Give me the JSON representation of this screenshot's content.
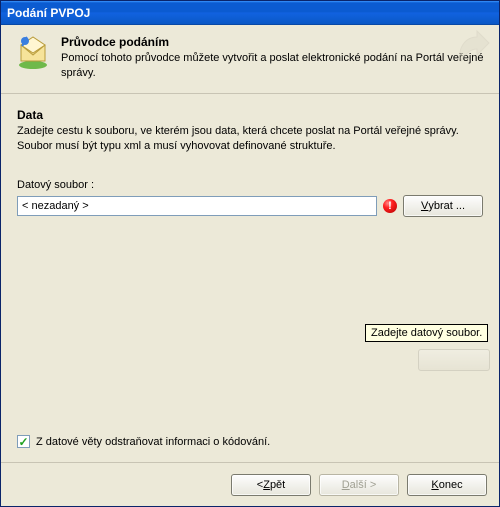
{
  "window": {
    "title": "Podání PVPOJ"
  },
  "header": {
    "title": "Průvodce podáním",
    "desc": "Pomocí tohoto průvodce můžete vytvořit a poslat elektronické podání na Portál veřejné správy."
  },
  "section": {
    "title": "Data",
    "desc": "Zadejte cestu k souboru, ve kterém jsou data, která chcete poslat na Portál veřejné správy. Soubor musí být typu xml a musí vyhovovat definované struktuře.",
    "file_label": "Datový soubor :",
    "file_value": "< nezadaný >",
    "browse_label_pre": "V",
    "browse_label_rest": "ybrat ...",
    "tooltip": "Zadejte datový soubor."
  },
  "checkbox": {
    "label": "Z datové věty odstraňovat informaci o kódování.",
    "checked": true
  },
  "footer": {
    "back_pre": "< ",
    "back_u": "Z",
    "back_rest": "pět",
    "next_u": "D",
    "next_rest": "alší >",
    "close_u": "K",
    "close_rest": "onec"
  }
}
